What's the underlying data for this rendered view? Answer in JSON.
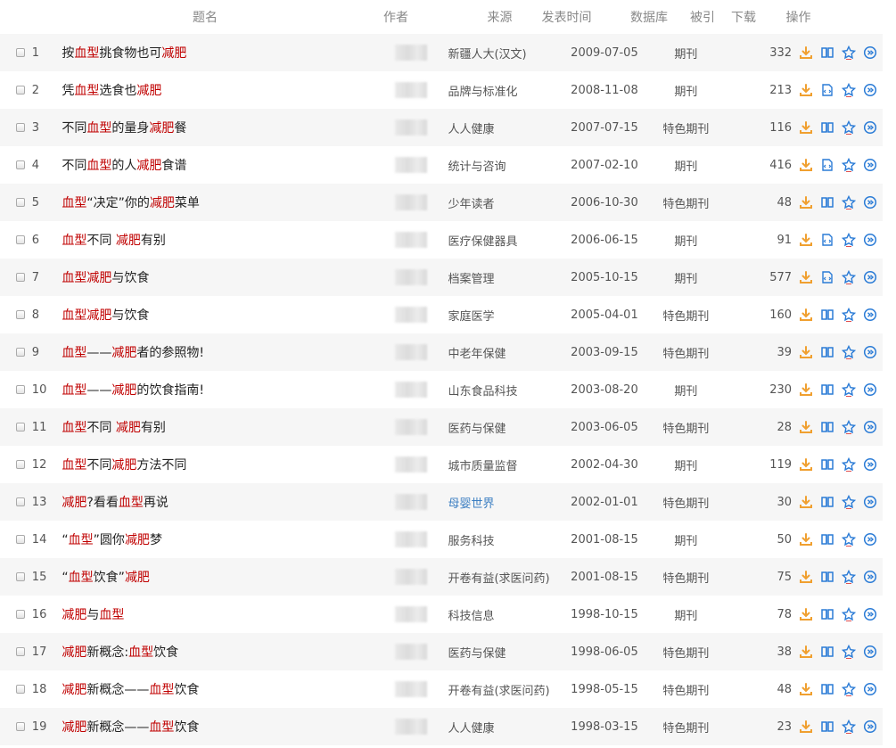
{
  "header": {
    "title": "题名",
    "author": "作者",
    "source": "来源",
    "date": "发表时间",
    "database": "数据库",
    "cited": "被引",
    "downloads": "下载",
    "actions": "操作"
  },
  "colors": {
    "highlight": "#c00000",
    "link": "#3b7ec2",
    "download_icon": "#f0a030",
    "action_icon": "#2a7bd6"
  },
  "rows": [
    {
      "num": "1",
      "title": [
        [
          "按",
          0
        ],
        [
          "血型",
          1
        ],
        [
          "挑食物也可",
          0
        ],
        [
          "减肥",
          1
        ]
      ],
      "source": "新疆人大(汉文)",
      "date": "2009-07-05",
      "db": "期刊",
      "downloads": "332",
      "reader": "book"
    },
    {
      "num": "2",
      "title": [
        [
          "凭",
          0
        ],
        [
          "血型",
          1
        ],
        [
          "选食也",
          0
        ],
        [
          "减肥",
          1
        ]
      ],
      "source": "品牌与标准化",
      "date": "2008-11-08",
      "db": "期刊",
      "downloads": "213",
      "reader": "html"
    },
    {
      "num": "3",
      "title": [
        [
          "不同",
          0
        ],
        [
          "血型",
          1
        ],
        [
          "的量身",
          0
        ],
        [
          "减肥",
          1
        ],
        [
          "餐",
          0
        ]
      ],
      "source": "人人健康",
      "date": "2007-07-15",
      "db": "特色期刊",
      "downloads": "116",
      "reader": "book"
    },
    {
      "num": "4",
      "title": [
        [
          "不同",
          0
        ],
        [
          "血型",
          1
        ],
        [
          "的人",
          0
        ],
        [
          "减肥",
          1
        ],
        [
          "食谱",
          0
        ]
      ],
      "source": "统计与咨询",
      "date": "2007-02-10",
      "db": "期刊",
      "downloads": "416",
      "reader": "html"
    },
    {
      "num": "5",
      "title": [
        [
          "血型",
          1
        ],
        [
          "“决定”你的",
          0
        ],
        [
          "减肥",
          1
        ],
        [
          "菜单",
          0
        ]
      ],
      "source": "少年读者",
      "date": "2006-10-30",
      "db": "特色期刊",
      "downloads": "48",
      "reader": "book"
    },
    {
      "num": "6",
      "title": [
        [
          "血型",
          1
        ],
        [
          "不同 ",
          0
        ],
        [
          "减肥",
          1
        ],
        [
          "有别",
          0
        ]
      ],
      "source": "医疗保健器具",
      "date": "2006-06-15",
      "db": "期刊",
      "downloads": "91",
      "reader": "html"
    },
    {
      "num": "7",
      "title": [
        [
          "血型",
          1
        ],
        [
          "减肥",
          1
        ],
        [
          "与饮食",
          0
        ]
      ],
      "source": "档案管理",
      "date": "2005-10-15",
      "db": "期刊",
      "downloads": "577",
      "reader": "html"
    },
    {
      "num": "8",
      "title": [
        [
          "血型",
          1
        ],
        [
          "减肥",
          1
        ],
        [
          "与饮食",
          0
        ]
      ],
      "source": "家庭医学",
      "date": "2005-04-01",
      "db": "特色期刊",
      "downloads": "160",
      "reader": "book"
    },
    {
      "num": "9",
      "title": [
        [
          "血型",
          1
        ],
        [
          "——",
          0
        ],
        [
          "减肥",
          1
        ],
        [
          "者的参照物!",
          0
        ]
      ],
      "source": "中老年保健",
      "date": "2003-09-15",
      "db": "特色期刊",
      "downloads": "39",
      "reader": "book"
    },
    {
      "num": "10",
      "title": [
        [
          "血型",
          1
        ],
        [
          "——",
          0
        ],
        [
          "减肥",
          1
        ],
        [
          "的饮食指南!",
          0
        ]
      ],
      "source": "山东食品科技",
      "date": "2003-08-20",
      "db": "期刊",
      "downloads": "230",
      "reader": "book"
    },
    {
      "num": "11",
      "title": [
        [
          "血型",
          1
        ],
        [
          "不同 ",
          0
        ],
        [
          "减肥",
          1
        ],
        [
          "有别",
          0
        ]
      ],
      "source": "医药与保健",
      "date": "2003-06-05",
      "db": "特色期刊",
      "downloads": "28",
      "reader": "book"
    },
    {
      "num": "12",
      "title": [
        [
          "血型",
          1
        ],
        [
          "不同",
          0
        ],
        [
          "减肥",
          1
        ],
        [
          "方法不同",
          0
        ]
      ],
      "source": "城市质量监督",
      "date": "2002-04-30",
      "db": "期刊",
      "downloads": "119",
      "reader": "book"
    },
    {
      "num": "13",
      "title": [
        [
          "减肥",
          1
        ],
        [
          "?看看",
          0
        ],
        [
          "血型",
          1
        ],
        [
          "再说",
          0
        ]
      ],
      "source": "母婴世界",
      "source_link": true,
      "date": "2002-01-01",
      "db": "特色期刊",
      "downloads": "30",
      "reader": "book"
    },
    {
      "num": "14",
      "title": [
        [
          " “",
          0
        ],
        [
          "血型",
          1
        ],
        [
          "”圆你",
          0
        ],
        [
          "减肥",
          1
        ],
        [
          "梦",
          0
        ]
      ],
      "source": "服务科技",
      "date": "2001-08-15",
      "db": "期刊",
      "downloads": "50",
      "reader": "book"
    },
    {
      "num": "15",
      "title": [
        [
          " “",
          0
        ],
        [
          "血型",
          1
        ],
        [
          "饮食”",
          0
        ],
        [
          "减肥",
          1
        ]
      ],
      "source": "开卷有益(求医问药)",
      "date": "2001-08-15",
      "db": "特色期刊",
      "downloads": "75",
      "reader": "book"
    },
    {
      "num": "16",
      "title": [
        [
          "减肥",
          1
        ],
        [
          "与",
          0
        ],
        [
          "血型",
          1
        ]
      ],
      "source": "科技信息",
      "date": "1998-10-15",
      "db": "期刊",
      "downloads": "78",
      "reader": "book"
    },
    {
      "num": "17",
      "title": [
        [
          "减肥",
          1
        ],
        [
          "新概念:",
          0
        ],
        [
          "血型",
          1
        ],
        [
          "饮食",
          0
        ]
      ],
      "source": "医药与保健",
      "date": "1998-06-05",
      "db": "特色期刊",
      "downloads": "38",
      "reader": "book"
    },
    {
      "num": "18",
      "title": [
        [
          "减肥",
          1
        ],
        [
          "新概念——",
          0
        ],
        [
          "血型",
          1
        ],
        [
          "饮食",
          0
        ]
      ],
      "source": "开卷有益(求医问药)",
      "date": "1998-05-15",
      "db": "特色期刊",
      "downloads": "48",
      "reader": "book"
    },
    {
      "num": "19",
      "title": [
        [
          "减肥",
          1
        ],
        [
          "新概念——",
          0
        ],
        [
          "血型",
          1
        ],
        [
          "饮食",
          0
        ]
      ],
      "source": "人人健康",
      "date": "1998-03-15",
      "db": "特色期刊",
      "downloads": "23",
      "reader": "book"
    }
  ]
}
